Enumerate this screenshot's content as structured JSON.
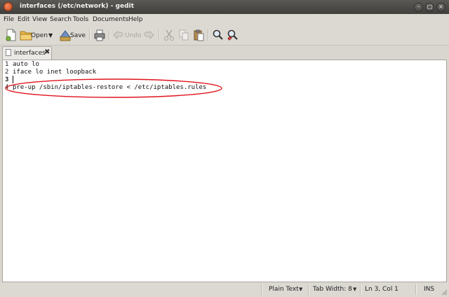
{
  "window": {
    "title": "interfaces (/etc/network) - gedit",
    "controls": {
      "minimize": "–",
      "maximize": "□",
      "close": "×"
    }
  },
  "menu": [
    "File",
    "Edit",
    "View",
    "Search",
    "Tools",
    "Documents",
    "Help"
  ],
  "toolbar": {
    "open_label": "Open",
    "save_label": "Save",
    "undo_label": "Undo"
  },
  "tab": {
    "label": "interfaces",
    "close": "✖"
  },
  "editor": {
    "lines": [
      {
        "num": "1",
        "text": "auto lo"
      },
      {
        "num": "2",
        "text": "iface lo inet loopback"
      },
      {
        "num": "3",
        "text": ""
      },
      {
        "num": "4",
        "text": "pre-up /sbin/iptables-restore < /etc/iptables.rules"
      }
    ],
    "current_line": 3,
    "annotation_color": "#e0141e"
  },
  "status": {
    "language": "Plain Text",
    "tab_width": "Tab Width:  8",
    "position": "Ln 3, Col 1",
    "mode": "INS"
  }
}
